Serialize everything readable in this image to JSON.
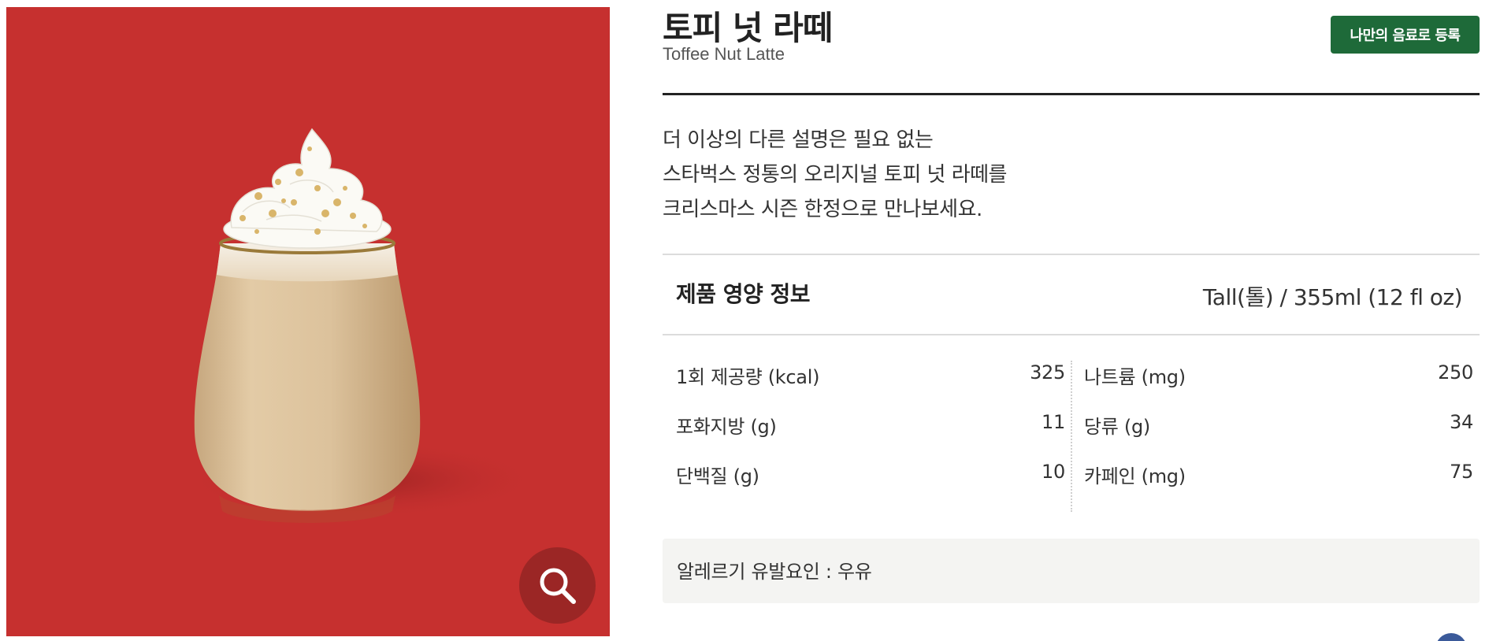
{
  "product": {
    "name_ko": "토피 넛 라떼",
    "name_en": "Toffee Nut Latte",
    "register_button": "나만의 음료로 등록",
    "description": [
      "더 이상의 다른 설명은 필요 없는",
      "스타벅스 정통의 오리지널 토피 넛 라떼를",
      "크리스마스 시즌 한정으로 만나보세요."
    ]
  },
  "image": {
    "background_color": "#c6302f",
    "zoom_icon": "magnifier-icon"
  },
  "nutrition": {
    "title": "제품 영양 정보",
    "size": "Tall(톨) / 355ml (12 fl oz)",
    "left": [
      {
        "label": "1회 제공량 (kcal)",
        "value": "325"
      },
      {
        "label": "포화지방 (g)",
        "value": "11"
      },
      {
        "label": "단백질 (g)",
        "value": "10"
      }
    ],
    "right": [
      {
        "label": "나트륨 (mg)",
        "value": "250"
      },
      {
        "label": "당류 (g)",
        "value": "34"
      },
      {
        "label": "카페인 (mg)",
        "value": "75"
      }
    ]
  },
  "allergy": {
    "text": "알레르기 유발요인 : 우유"
  },
  "colors": {
    "accent_green": "#1e6a39",
    "panel_red": "#c6302f"
  }
}
